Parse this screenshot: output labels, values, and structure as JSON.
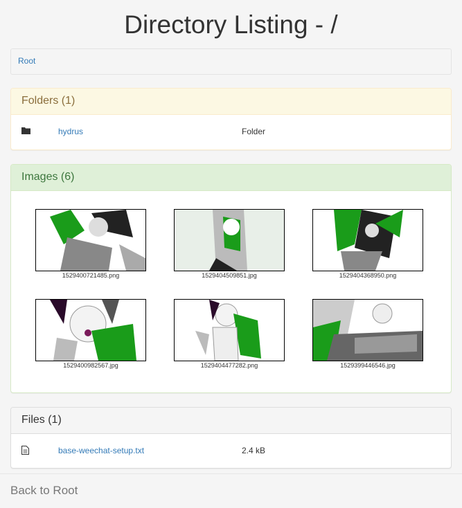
{
  "page": {
    "title": "Directory Listing - /"
  },
  "breadcrumb": {
    "items": [
      "Root"
    ]
  },
  "folders": {
    "heading": "Folders (1)",
    "items": [
      {
        "name": "hydrus",
        "type": "Folder"
      }
    ]
  },
  "images": {
    "heading": "Images (6)",
    "items": [
      "1529400721485.png",
      "1529404509851.jpg",
      "1529404368950.png",
      "1529400982567.jpg",
      "1529404477282.png",
      "1529399446546.jpg"
    ]
  },
  "files": {
    "heading": "Files (1)",
    "items": [
      {
        "name": "base-weechat-setup.txt",
        "size": "2.4 kB"
      }
    ]
  },
  "footer": {
    "back_label": "Back to Root"
  },
  "colors": {
    "link": "#337ab7",
    "folders_heading_bg": "#fcf8e3",
    "images_heading_bg": "#dff0d8",
    "thumb_accent": "#1a9c1a"
  }
}
